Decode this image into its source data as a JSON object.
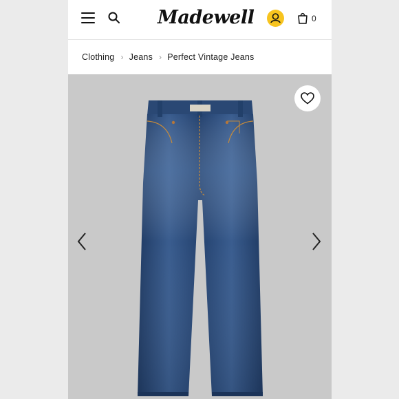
{
  "header": {
    "brand": "Madewell",
    "bag_count": "0",
    "icons": {
      "menu": "hamburger-menu-icon",
      "search": "search-icon",
      "account": "user-icon",
      "bag": "shopping-bag-icon"
    },
    "account_color": "#f7c41f"
  },
  "breadcrumb": {
    "items": [
      {
        "label": "Clothing"
      },
      {
        "label": "Jeans"
      },
      {
        "label": "Perfect Vintage Jeans"
      }
    ],
    "separator_icon": "chevron-right-icon"
  },
  "gallery": {
    "image": "product-photo-dark-wash-straight-jeans",
    "icons": {
      "favorite": "heart-icon",
      "prev": "chevron-left-icon",
      "next": "chevron-right-icon"
    },
    "background": "#c9c9c9",
    "denim_color": "#2b4a78"
  }
}
